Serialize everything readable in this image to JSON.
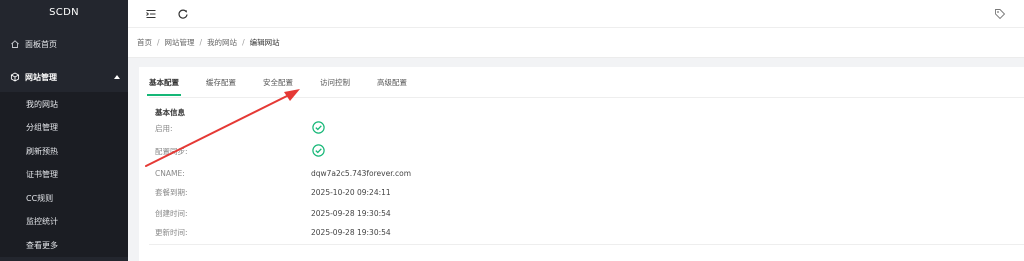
{
  "brand": "SCDN",
  "sidebar": {
    "dashboard": {
      "label": "面板首页",
      "icon": "home-icon"
    },
    "site_mgmt": {
      "label": "网站管理",
      "icon": "cube-icon"
    },
    "sub_items": [
      "我的网站",
      "分组管理",
      "刷新预热",
      "证书管理",
      "CC规则"
    ],
    "monitor": {
      "label": "监控统计"
    },
    "more": {
      "label": "查看更多"
    }
  },
  "topbar": {
    "menu_icon": "menu-fold-icon",
    "refresh_icon": "refresh-icon",
    "tag_icon": "tag-icon"
  },
  "breadcrumb": [
    "首页",
    "网站管理",
    "我的网站",
    "编辑网站"
  ],
  "breadcrumb_sep": "/",
  "tabs": [
    "基本配置",
    "缓存配置",
    "安全配置",
    "访问控制",
    "高级配置"
  ],
  "active_tab": "基本配置",
  "section": {
    "title": "基本信息",
    "enabled_label": "启用:",
    "enabled": true,
    "sync_label": "配置同步:",
    "sync": true,
    "cname_label": "CNAME:",
    "cname": "dqw7a2c5.743forever.com",
    "expire_label": "套餐到期:",
    "expire": "2025-10-20 09:24:11",
    "created_label": "创建时间:",
    "created": "2025-09-28 19:30:54",
    "updated_label": "更新时间:",
    "updated": "2025-09-28 19:30:54"
  },
  "colors": {
    "sidebar_bg": "#23262e",
    "accent": "#16b777",
    "annotation": "#e53935"
  }
}
